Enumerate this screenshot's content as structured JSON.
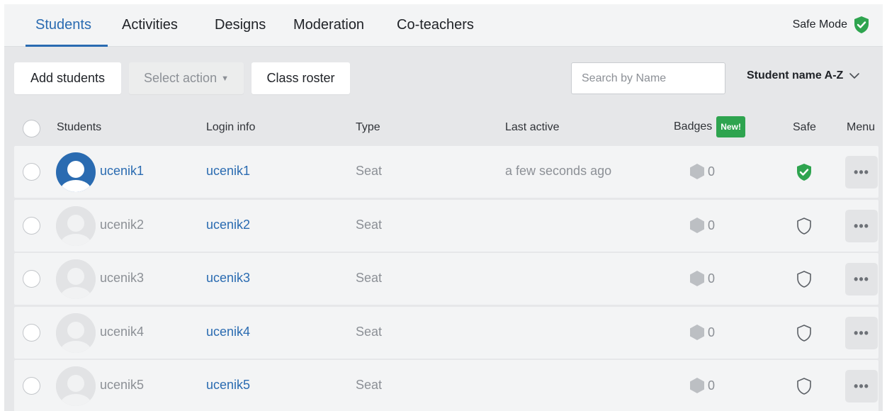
{
  "tabs": [
    {
      "label": "Students",
      "active": true
    },
    {
      "label": "Activities"
    },
    {
      "label": "Designs"
    },
    {
      "label": "Moderation"
    },
    {
      "label": "Co-teachers"
    }
  ],
  "safe_mode": {
    "label": "Safe Mode",
    "enabled": true,
    "icon": "shield-check-icon"
  },
  "toolbar": {
    "add_students": "Add students",
    "select_action": "Select action",
    "class_roster": "Class roster",
    "search_placeholder": "Search by Name",
    "sort_label": "Student name A-Z"
  },
  "table": {
    "headers": {
      "students": "Students",
      "login": "Login info",
      "type": "Type",
      "last_active": "Last active",
      "badges": "Badges",
      "badges_new": "New!",
      "safe": "Safe",
      "menu": "Menu"
    },
    "rows": [
      {
        "name": "ucenik1",
        "login": "ucenik1",
        "type": "Seat",
        "last_active": "a few seconds ago",
        "badges": "0",
        "safe": true,
        "active": true
      },
      {
        "name": "ucenik2",
        "login": "ucenik2",
        "type": "Seat",
        "last_active": "",
        "badges": "0",
        "safe": false,
        "active": false
      },
      {
        "name": "ucenik3",
        "login": "ucenik3",
        "type": "Seat",
        "last_active": "",
        "badges": "0",
        "safe": false,
        "active": false
      },
      {
        "name": "ucenik4",
        "login": "ucenik4",
        "type": "Seat",
        "last_active": "",
        "badges": "0",
        "safe": false,
        "active": false
      },
      {
        "name": "ucenik5",
        "login": "ucenik5",
        "type": "Seat",
        "last_active": "",
        "badges": "0",
        "safe": false,
        "active": false
      }
    ],
    "menu_glyph": "•••"
  },
  "colors": {
    "accent": "#2a6bb1",
    "safe_green": "#2ea44f",
    "muted_text": "#8c9096",
    "row_bg": "#f3f4f5",
    "page_bg": "#e6e7e9"
  }
}
